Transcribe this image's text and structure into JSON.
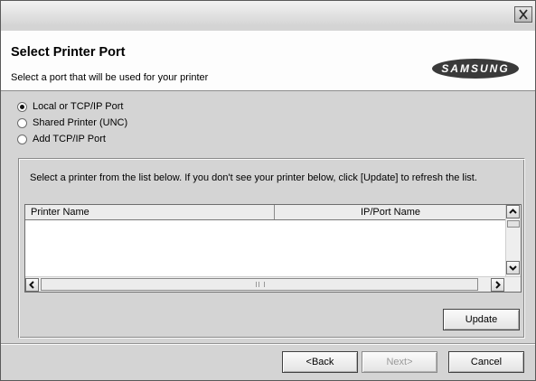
{
  "window": {
    "close_icon": "close-icon"
  },
  "header": {
    "title": "Select Printer Port",
    "subtitle": "Select a port that will be used for your printer",
    "logo_text": "SAMSUNG",
    "logo_color": "#3a3a3a"
  },
  "port_options": [
    {
      "label": "Local or TCP/IP Port",
      "selected": true
    },
    {
      "label": "Shared Printer (UNC)",
      "selected": false
    },
    {
      "label": "Add TCP/IP Port",
      "selected": false
    }
  ],
  "printer_list": {
    "instructions": "Select a printer from the list below. If you don't see your printer below, click [Update] to refresh the list.",
    "columns": [
      "Printer Name",
      "IP/Port Name"
    ],
    "rows": []
  },
  "buttons": {
    "update": "Update",
    "back": "<Back",
    "next": "Next>",
    "cancel": "Cancel"
  }
}
